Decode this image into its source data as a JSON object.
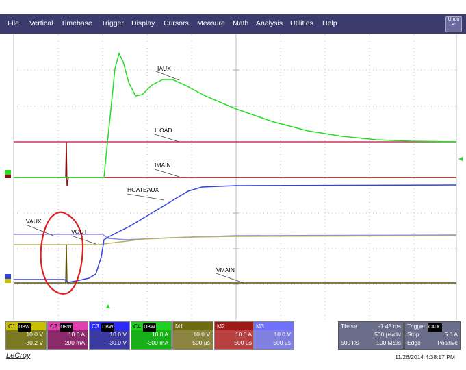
{
  "menu": [
    "File",
    "Vertical",
    "Timebase",
    "Trigger",
    "Display",
    "Cursors",
    "Measure",
    "Math",
    "Analysis",
    "Utilities",
    "Help"
  ],
  "undo_label": "Undo",
  "trace_labels": {
    "iaux": "IAUX",
    "iload": "ILOAD",
    "imain": "IMAIN",
    "hgateaux": "HGATEAUX",
    "vaux": "VAUX",
    "vout": "VOUT",
    "vmain": "VMAIN"
  },
  "channels": [
    {
      "name": "C1",
      "tags": [
        "DC",
        "B",
        "W"
      ],
      "scale": "10.0 V",
      "offset": "-30.2 V",
      "color": "#c8c000",
      "text": "#000"
    },
    {
      "name": "C2",
      "tags": [
        "DC",
        "B",
        "W"
      ],
      "scale": "10.0 A",
      "offset": "-200 mA",
      "color": "#e040b0",
      "text": "#000"
    },
    {
      "name": "C3",
      "tags": [
        "DC",
        "B",
        "W"
      ],
      "scale": "10.0 V",
      "offset": "-30.0 V",
      "color": "#2a2aff",
      "text": "#fff"
    },
    {
      "name": "C4",
      "tags": [
        "DC",
        "B",
        "W"
      ],
      "scale": "10.0 A",
      "offset": "-300 mA",
      "color": "#20d020",
      "text": "#000"
    },
    {
      "name": "M1",
      "tags": [],
      "scale": "10.0 V",
      "offset": "500 µs",
      "color": "#6e6a10",
      "text": "#fff"
    },
    {
      "name": "M2",
      "tags": [],
      "scale": "10.0 A",
      "offset": "500 µs",
      "color": "#a01818",
      "text": "#fff"
    },
    {
      "name": "M3",
      "tags": [],
      "scale": "10.0 V",
      "offset": "500 µs",
      "color": "#7070ff",
      "text": "#fff"
    }
  ],
  "timebase": {
    "label": "Tbase",
    "delay": "-1.43 ms",
    "div": "500 µs/div",
    "samples": "500 kS",
    "rate": "100 MS/s"
  },
  "trigger": {
    "label": "Trigger",
    "chan": "C4",
    "coupling": "DC",
    "mode": "Stop",
    "level": "5.0 A",
    "type": "Edge",
    "slope": "Positive"
  },
  "brand": "LeCroy",
  "datetime": "11/26/2014 4:38:17 PM",
  "colors": {
    "iaux": "#22dd22",
    "iload": "#cc3366",
    "imain": "#8b1010",
    "hgateaux": "#3344dd",
    "vaux": "#8888ee",
    "vout": "#b8b060",
    "vmain": "#5a5000",
    "annotation": "#e02020"
  }
}
